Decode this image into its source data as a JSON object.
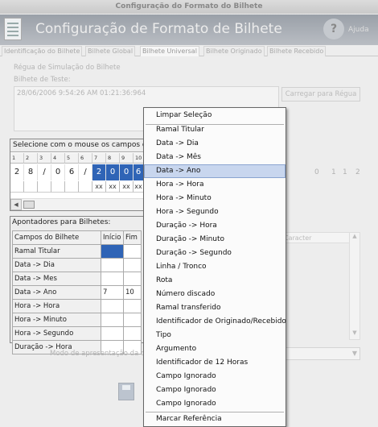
{
  "window": {
    "title": "Configuração do Formato do Bilhete",
    "header_title": "Configuração de Formato de Bilhete",
    "help_label": "Ajuda"
  },
  "tabs": [
    "Identificação do Bilhete",
    "Bilhete Global",
    "Bilhete Universal",
    "Bilhete Originado",
    "Bilhete Recebido"
  ],
  "ruler": {
    "label": "Régua de Simulação do Bilhete",
    "test_label": "Bilhete de Teste:",
    "test_value": "28/06/2006 9:54:26 AM 01:21:36:964",
    "load_button": "Carregar para Régua"
  },
  "selector": {
    "header": "Selecione com o mouse os campos do",
    "positions": [
      "1",
      "2",
      "3",
      "4",
      "5",
      "6",
      "7",
      "8",
      "9",
      "10"
    ],
    "chars": [
      "2",
      "8",
      "/",
      "0",
      "6",
      "/",
      "2",
      "0",
      "0",
      "6"
    ],
    "selected_from": 6,
    "marks": [
      "",
      "",
      "",
      "",
      "",
      "",
      "xx",
      "xx",
      "xx",
      "xx"
    ],
    "right_digits": [
      "0",
      "1",
      "1",
      "2"
    ]
  },
  "pointers": {
    "header": "Apontadores para Bilhetes:",
    "columns": [
      "Campos do Bilhete",
      "Início",
      "Fim"
    ],
    "rows": [
      {
        "field": "Ramal Titular",
        "start": "",
        "end": ""
      },
      {
        "field": "Data -> Dia",
        "start": "",
        "end": ""
      },
      {
        "field": "Data -> Mes",
        "start": "",
        "end": ""
      },
      {
        "field": "Data -> Ano",
        "start": "7",
        "end": "10"
      },
      {
        "field": "Hora -> Hora",
        "start": "",
        "end": ""
      },
      {
        "field": "Hora -> Minuto",
        "start": "",
        "end": ""
      },
      {
        "field": "Hora -> Segundo",
        "start": "",
        "end": ""
      },
      {
        "field": "Duração -> Hora",
        "start": "",
        "end": ""
      }
    ],
    "right_header": "Caracter"
  },
  "mode": {
    "label": "Modo de apresentação da duração:"
  },
  "context_menu": {
    "items": [
      "Limpar Seleção",
      "Ramal Titular",
      "Data -> Dia",
      "Data -> Mês",
      "Data -> Ano",
      "Hora -> Hora",
      "Hora -> Minuto",
      "Hora -> Segundo",
      "Duração -> Hora",
      "Duração -> Minuto",
      "Duração -> Segundo",
      "Linha / Tronco",
      "Rota",
      "Número discado",
      "Ramal transferido",
      "Identificador de Originado/Recebido",
      "Tipo",
      "Argumento",
      "Identificador de 12 Horas",
      "Campo Ignorado",
      "Campo Ignorado",
      "Campo Ignorado",
      "Marcar Referência"
    ],
    "highlighted_index": 4
  },
  "colors": {
    "selection_blue": "#2f64b6",
    "menu_highlight": "#c8d6ee"
  }
}
